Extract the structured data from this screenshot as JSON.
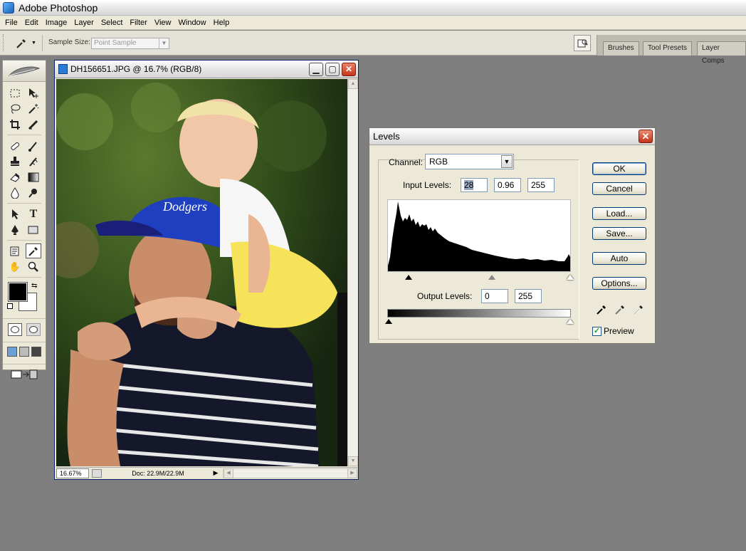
{
  "app": {
    "title": "Adobe Photoshop"
  },
  "menu": [
    "File",
    "Edit",
    "Image",
    "Layer",
    "Select",
    "Filter",
    "View",
    "Window",
    "Help"
  ],
  "options_bar": {
    "sample_size_label": "Sample Size:",
    "sample_size_value": "Point Sample",
    "palette_well_tabs": [
      "Brushes",
      "Tool Presets",
      "Layer Comps"
    ]
  },
  "toolbox": {
    "tools": [
      "marquee-icon",
      "move-icon",
      "lasso-icon",
      "magic-wand-icon",
      "crop-icon",
      "slice-icon",
      "healing-brush-icon",
      "brush-icon",
      "clone-stamp-icon",
      "history-brush-icon",
      "eraser-icon",
      "gradient-icon",
      "blur-icon",
      "dodge-icon",
      "path-selection-icon",
      "type-icon",
      "pen-icon",
      "rectangle-icon",
      "notes-icon",
      "eyedropper-icon",
      "hand-icon",
      "zoom-icon"
    ],
    "selected_tool": "eyedropper-icon",
    "foreground_color": "#000000",
    "background_color": "#ffffff"
  },
  "document": {
    "title": "DH156651.JPG @ 16.7% (RGB/8)",
    "zoom": "16.67%",
    "doc_info": "Doc: 22.9M/22.9M"
  },
  "levels": {
    "title": "Levels",
    "channel_label": "Channel:",
    "channel_value": "RGB",
    "input_levels_label": "Input Levels:",
    "input_black": "28",
    "input_gamma": "0.96",
    "input_white": "255",
    "output_levels_label": "Output Levels:",
    "output_black": "0",
    "output_white": "255",
    "buttons": {
      "ok": "OK",
      "cancel": "Cancel",
      "load": "Load...",
      "save": "Save...",
      "auto": "Auto",
      "options": "Options..."
    },
    "preview_label": "Preview",
    "preview_checked": true
  }
}
